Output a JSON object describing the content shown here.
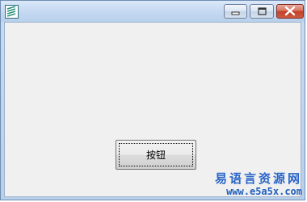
{
  "window": {
    "button_label": "按钮",
    "icons": {
      "app": "app-icon",
      "minimize": "minimize-icon",
      "maximize": "maximize-icon",
      "close": "close-icon"
    }
  },
  "watermark": {
    "title": "易语言资源网",
    "url": "www.e5a5x.com"
  },
  "colors": {
    "client_background": "#f0f0f0",
    "close_button": "#c0402a",
    "watermark_text": "#2a66c8"
  }
}
